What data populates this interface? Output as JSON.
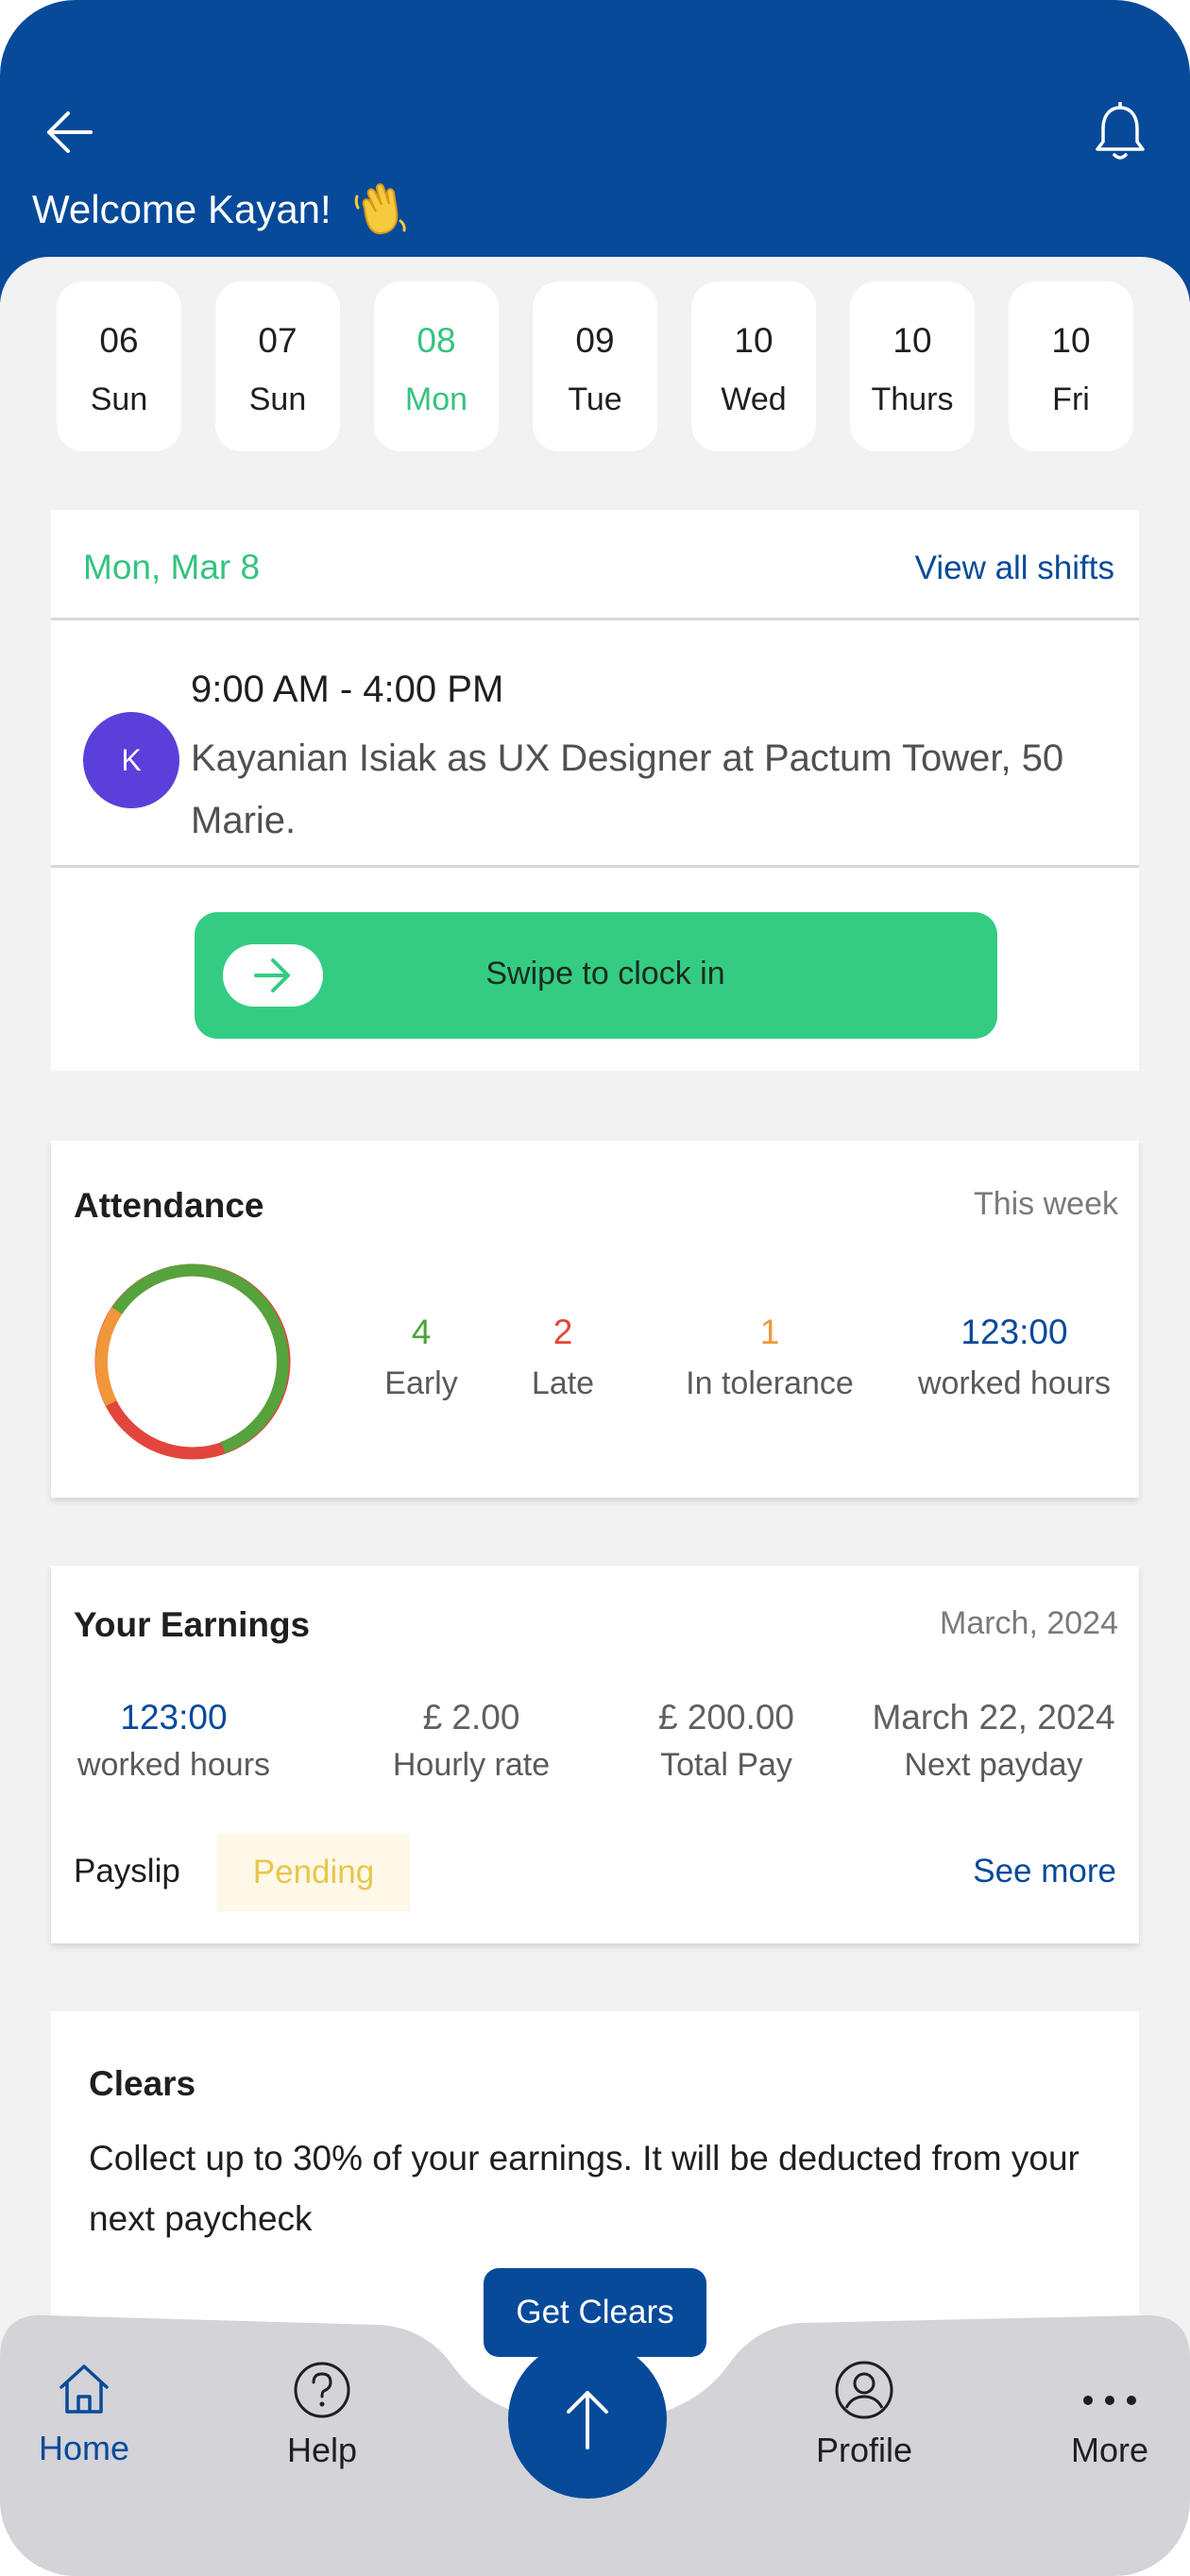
{
  "header": {
    "welcome": "Welcome Kayan!",
    "back_icon": "arrow-left-icon",
    "bell_icon": "bell-icon",
    "wave_icon": "waving-hand-emoji"
  },
  "days": [
    {
      "num": "06",
      "name": "Sun"
    },
    {
      "num": "07",
      "name": "Sun"
    },
    {
      "num": "08",
      "name": "Mon",
      "active": true
    },
    {
      "num": "09",
      "name": "Tue"
    },
    {
      "num": "10",
      "name": "Wed"
    },
    {
      "num": "10",
      "name": "Thurs"
    },
    {
      "num": "10",
      "name": "Fri"
    }
  ],
  "shift": {
    "date": "Mon, Mar 8",
    "view_all": "View all shifts",
    "avatar_initial": "K",
    "time": "9:00 AM - 4:00 PM",
    "description": "Kayanian Isiak as UX Designer at Pactum Tower, 50 Marie.",
    "swipe_label": "Swipe to clock in"
  },
  "attendance": {
    "title": "Attendance",
    "period": "This week",
    "stats": [
      {
        "value": "4",
        "label": "Early",
        "color": "#4ea33b"
      },
      {
        "value": "2",
        "label": "Late",
        "color": "#e2453b"
      },
      {
        "value": "1",
        "label": "In tolerance",
        "color": "#f0973a"
      },
      {
        "value": "123:00",
        "label": "worked hours",
        "color": "#074a9a"
      }
    ]
  },
  "earnings": {
    "title": "Your Earnings",
    "period": "March, 2024",
    "worked_hours": "123:00",
    "worked_hours_label": "worked hours",
    "hourly_rate": "£ 2.00",
    "hourly_rate_label": "Hourly rate",
    "total_pay": "£ 200.00",
    "total_pay_label": "Total Pay",
    "next_payday": "March 22, 2024",
    "next_payday_label": "Next payday",
    "payslip_label": "Payslip",
    "payslip_status": "Pending",
    "see_more": "See more"
  },
  "clears": {
    "title": "Clears",
    "text": "Collect up to 30% of your earnings. It will be deducted from your next paycheck",
    "button": "Get Clears"
  },
  "nav": {
    "home": "Home",
    "help": "Help",
    "profile": "Profile",
    "more": "More"
  },
  "colors": {
    "primary": "#074a9a",
    "accent_green": "#35c37f",
    "swipe_green": "#34cc83"
  }
}
